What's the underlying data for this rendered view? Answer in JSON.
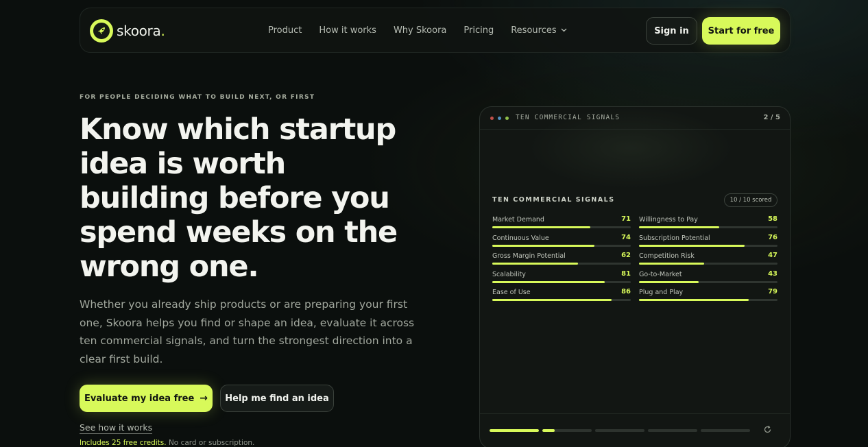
{
  "nav": {
    "logo_text": "skoora",
    "logo_dot": ".",
    "links": [
      {
        "label": "Product"
      },
      {
        "label": "How it works"
      },
      {
        "label": "Why Skoora"
      },
      {
        "label": "Pricing"
      },
      {
        "label": "Resources"
      }
    ],
    "signin_label": "Sign in",
    "start_label": "Start for free"
  },
  "hero": {
    "eyebrow": "FOR PEOPLE DECIDING WHAT TO BUILD NEXT, OR FIRST",
    "headline": "Know which startup idea is worth building before you spend weeks on the wrong one.",
    "subcopy": "Whether you already ship products or are preparing your first one, Skoora helps you find or shape an idea, evaluate it across ten commercial signals, and turn the strongest direction into a clear first build.",
    "evaluate_label": "Evaluate my idea free",
    "evaluate_arrow": "→",
    "help_label": "Help me find an idea",
    "see_how_label": "See how it works",
    "credits_highlight": "Includes 25 free credits.",
    "credits_rest": "No card or subscription."
  },
  "card": {
    "top_title": "TEN COMMERCIAL SIGNALS",
    "page_indicator": "2 / 5",
    "section_title": "TEN COMMERCIAL SIGNALS",
    "scored_badge": "10 / 10 scored",
    "dot_colors": [
      "#c0504a",
      "#4f8fc0",
      "#8fbf4a"
    ],
    "accent": "#d8f95a",
    "metrics_left": [
      {
        "label": "Market Demand",
        "value": "71"
      },
      {
        "label": "Continuous Value",
        "value": "74"
      },
      {
        "label": "Gross Margin Potential",
        "value": "62"
      },
      {
        "label": "Scalability",
        "value": "81"
      },
      {
        "label": "Ease of Use",
        "value": "86"
      }
    ],
    "metrics_right": [
      {
        "label": "Willingness to Pay",
        "value": "58"
      },
      {
        "label": "Subscription Potential",
        "value": "76"
      },
      {
        "label": "Competition Risk",
        "value": "47"
      },
      {
        "label": "Go-to-Market",
        "value": "43"
      },
      {
        "label": "Plug and Play",
        "value": "79"
      }
    ],
    "steps_progress": [
      1,
      0.25,
      0,
      0,
      0
    ],
    "refresh_icon": "refresh-icon"
  }
}
